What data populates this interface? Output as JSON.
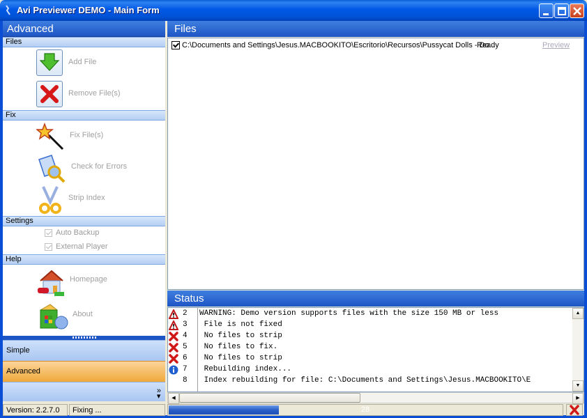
{
  "window": {
    "title": "Avi Previewer DEMO -  Main Form"
  },
  "left_panel": {
    "header": "Advanced",
    "groups": {
      "files": {
        "label": "Files",
        "items": [
          {
            "label": "Add File",
            "icon": "add-file-icon"
          },
          {
            "label": "Remove File(s)",
            "icon": "remove-file-icon"
          }
        ]
      },
      "fix": {
        "label": "Fix",
        "items": [
          {
            "label": "Fix File(s)",
            "icon": "magic-wand-icon"
          },
          {
            "label": "Check for Errors",
            "icon": "magnifier-document-icon"
          },
          {
            "label": "Strip Index",
            "icon": "scissors-icon"
          }
        ]
      },
      "settings": {
        "label": "Settings",
        "items": [
          {
            "label": "Auto Backup",
            "checked": true
          },
          {
            "label": "External Player",
            "checked": true
          }
        ]
      },
      "help": {
        "label": "Help",
        "items": [
          {
            "label": "Homepage",
            "icon": "home-icon"
          },
          {
            "label": "About",
            "icon": "about-box-icon"
          }
        ]
      }
    },
    "nav": [
      {
        "label": "Simple",
        "active": false
      },
      {
        "label": "Advanced",
        "active": true
      }
    ]
  },
  "files_panel": {
    "header": "Files",
    "rows": [
      {
        "checked": true,
        "path": "C:\\Documents and Settings\\Jesus.MACBOOKITO\\Escritorio\\Recursos\\Pussycat Dolls - Do...",
        "status": "Ready",
        "action": "Preview"
      }
    ]
  },
  "status_panel": {
    "header": "Status",
    "log": [
      {
        "icon": "warning",
        "num": "2",
        "msg": "WARNING: Demo version supports files with the size 150 MB or less"
      },
      {
        "icon": "warning",
        "num": "3",
        "msg": " File is not fixed"
      },
      {
        "icon": "error",
        "num": "4",
        "msg": " No files to strip"
      },
      {
        "icon": "error",
        "num": "5",
        "msg": " No files to fix."
      },
      {
        "icon": "error",
        "num": "6",
        "msg": " No files to strip"
      },
      {
        "icon": "info",
        "num": "7",
        "msg": " Rebuilding index..."
      },
      {
        "icon": "none",
        "num": "8",
        "msg": " Index rebuilding for file: C:\\Documents and Settings\\Jesus.MACBOOKITO\\E"
      }
    ]
  },
  "statusbar": {
    "version": "Version: 2.2.7.0",
    "state": "Fixing ...",
    "progress_value": 28,
    "progress_label": "28"
  }
}
